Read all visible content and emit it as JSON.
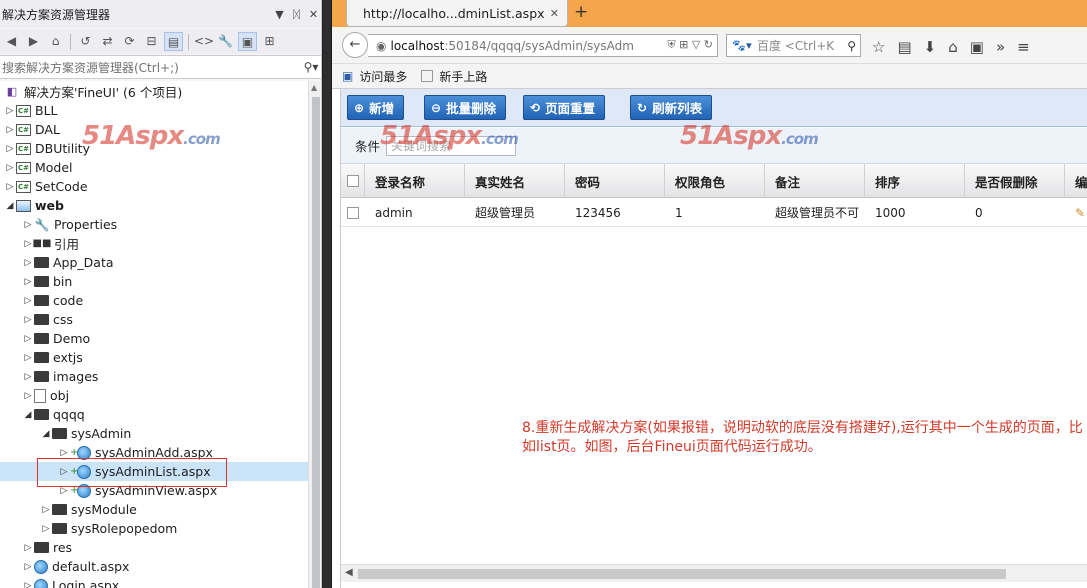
{
  "solution_explorer": {
    "title": "解决方案资源管理器",
    "search_placeholder": "搜索解决方案资源管理器(Ctrl+;)",
    "tree": [
      {
        "label": "解决方案'FineUI' (6 个项目)",
        "icon": "solution-icon",
        "depth": 0
      },
      {
        "label": "BLL",
        "icon": "csharp-project-icon",
        "depth": 0
      },
      {
        "label": "DAL",
        "icon": "csharp-project-icon",
        "depth": 0
      },
      {
        "label": "DBUtility",
        "icon": "csharp-project-icon",
        "depth": 0
      },
      {
        "label": "Model",
        "icon": "csharp-project-icon",
        "depth": 0
      },
      {
        "label": "SetCode",
        "icon": "csharp-project-icon",
        "depth": 0
      },
      {
        "label": "web",
        "icon": "web-project-icon",
        "depth": 0,
        "expanded": true
      },
      {
        "label": "Properties",
        "icon": "wrench-icon",
        "depth": 1
      },
      {
        "label": "引用",
        "icon": "reference-icon",
        "depth": 1
      },
      {
        "label": "App_Data",
        "icon": "folder-icon",
        "depth": 1
      },
      {
        "label": "bin",
        "icon": "folder-icon",
        "depth": 1
      },
      {
        "label": "code",
        "icon": "folder-icon",
        "depth": 1
      },
      {
        "label": "css",
        "icon": "folder-icon",
        "depth": 1
      },
      {
        "label": "Demo",
        "icon": "folder-icon",
        "depth": 1
      },
      {
        "label": "extjs",
        "icon": "folder-icon",
        "depth": 1
      },
      {
        "label": "images",
        "icon": "folder-icon",
        "depth": 1
      },
      {
        "label": "obj",
        "icon": "file-icon",
        "depth": 1
      },
      {
        "label": "qqqq",
        "icon": "folder-icon",
        "depth": 1,
        "expanded": true
      },
      {
        "label": "sysAdmin",
        "icon": "folder-icon",
        "depth": 2,
        "expanded": true
      },
      {
        "label": "sysAdminAdd.aspx",
        "icon": "aspx-icon",
        "depth": 3
      },
      {
        "label": "sysAdminList.aspx",
        "icon": "aspx-icon",
        "depth": 3,
        "selected": true
      },
      {
        "label": "sysAdminView.aspx",
        "icon": "aspx-icon",
        "depth": 3
      },
      {
        "label": "sysModule",
        "icon": "folder-icon",
        "depth": 2
      },
      {
        "label": "sysRolepopedom",
        "icon": "folder-icon",
        "depth": 2
      },
      {
        "label": "res",
        "icon": "folder-icon",
        "depth": 1
      },
      {
        "label": "default.aspx",
        "icon": "aspx-icon",
        "depth": 1
      },
      {
        "label": "Login.aspx",
        "icon": "aspx-icon",
        "depth": 1
      }
    ]
  },
  "browser": {
    "tab_title": "http://localho...dminList.aspx",
    "url_host": "localhost",
    "url_rest": ":50184/qqqq/sysAdmin/sysAdm",
    "search_placeholder": "百度 <Ctrl+K",
    "bookmarks": [
      "访问最多",
      "新手上路"
    ]
  },
  "app": {
    "buttons": [
      {
        "label": "新增",
        "icon": "add-icon"
      },
      {
        "label": "批量删除",
        "icon": "delete-icon"
      },
      {
        "label": "页面重置",
        "icon": "reset-icon"
      },
      {
        "label": "刷新列表",
        "icon": "refresh-icon"
      }
    ],
    "filter_label": "条件",
    "filter_placeholder": "关键词搜索",
    "columns": [
      "登录名称",
      "真实姓名",
      "密码",
      "权限角色",
      "备注",
      "排序",
      "是否假删除",
      "编"
    ],
    "rows": [
      [
        "admin",
        "超级管理员",
        "123456",
        "1",
        "超级管理员不可",
        "1000",
        "0"
      ]
    ],
    "note": "8.重新生成解决方案(如果报错，说明动软的底层没有搭建好),运行其中一个生成的页面，比如list页。如图，后台Fineui页面代码运行成功。"
  },
  "watermark": {
    "main": "51Aspx",
    "suffix": ".com"
  },
  "colors": {
    "firefox_tabbar": "#f5a54a",
    "button_blue": "#2263b5",
    "note_red": "#d23a2a",
    "selection_box": "#d9332e"
  }
}
